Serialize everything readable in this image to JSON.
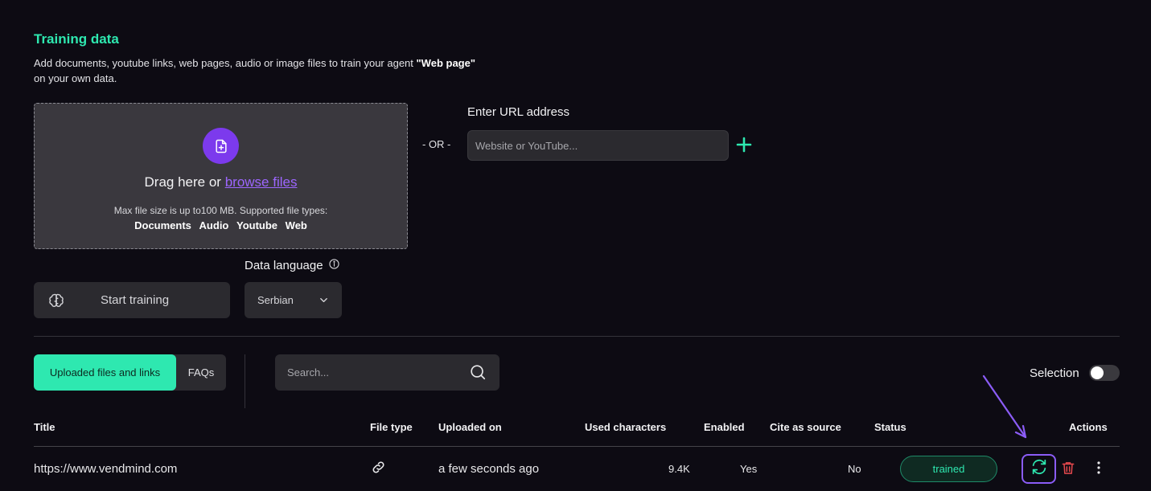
{
  "header": {
    "title": "Training data",
    "desc_part1": "Add documents, youtube links, web pages, audio or image files to train your agent ",
    "agent_name": "\"Web page\"",
    "desc_part2": "on your own data."
  },
  "dropzone": {
    "drag_text": "Drag here or ",
    "browse_link": "browse files",
    "max_size": "Max file size is up to100 MB. Supported file types:",
    "types": [
      "Documents",
      "Audio",
      "Youtube",
      "Web"
    ]
  },
  "or_separator": "- OR -",
  "url": {
    "label": "Enter URL address",
    "placeholder": "Website or YouTube...",
    "add_icon": "plus-icon"
  },
  "training": {
    "start_label": "Start training",
    "language_label": "Data language",
    "language_value": "Serbian"
  },
  "tabs": [
    {
      "label": "Uploaded files and links",
      "active": true
    },
    {
      "label": "FAQs",
      "active": false
    }
  ],
  "search": {
    "placeholder": "Search..."
  },
  "selection": {
    "label": "Selection",
    "enabled": false
  },
  "table": {
    "headers": {
      "title": "Title",
      "file_type": "File type",
      "uploaded_on": "Uploaded on",
      "used_characters": "Used characters",
      "enabled": "Enabled",
      "cite": "Cite as source",
      "status": "Status",
      "actions": "Actions"
    },
    "rows": [
      {
        "title": "https://www.vendmind.com",
        "file_type_icon": "link-icon",
        "uploaded_on": "a few seconds ago",
        "used_characters": "9.4K",
        "enabled": "Yes",
        "cite": "No",
        "status": "trained"
      }
    ]
  },
  "colors": {
    "accent_green": "#2ee8b0",
    "accent_purple": "#7c3aed",
    "danger": "#e5484d",
    "background": "#0d0b13"
  }
}
